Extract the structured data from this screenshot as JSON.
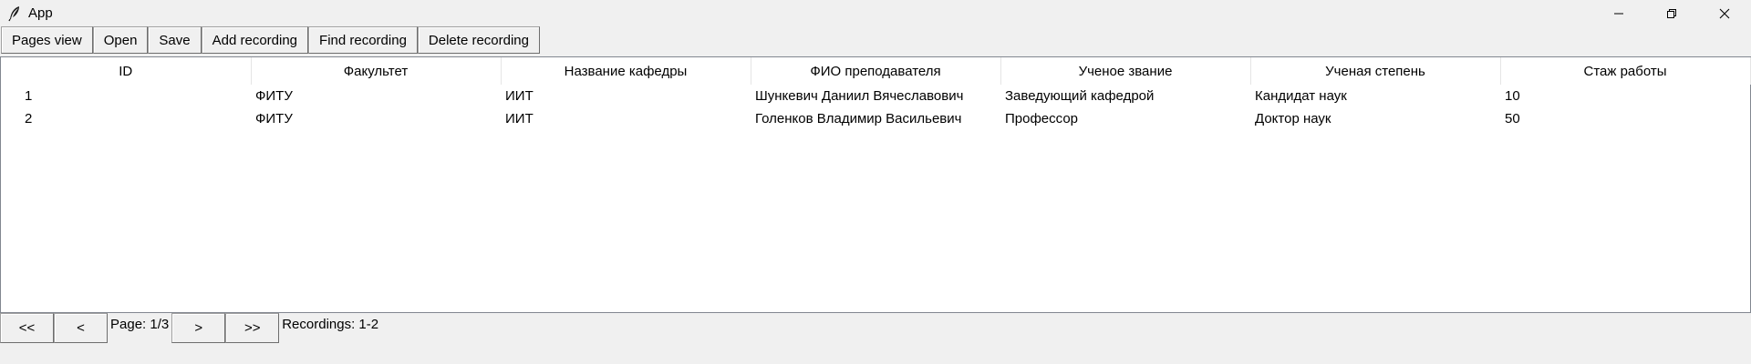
{
  "window": {
    "title": "App",
    "icon": "feather-icon"
  },
  "toolbar": {
    "buttons": [
      "Pages view",
      "Open",
      "Save",
      "Add recording",
      "Find recording",
      "Delete recording"
    ]
  },
  "table": {
    "columns": [
      "ID",
      "Факультет",
      "Название кафедры",
      "ФИО преподавателя",
      "Ученое звание",
      "Ученая степень",
      "Стаж работы"
    ],
    "rows": [
      [
        "1",
        "ФИТУ",
        "ИИТ",
        "Шункевич Даниил Вячеславович",
        "Заведующий кафедрой",
        "Кандидат наук",
        "10"
      ],
      [
        "2",
        "ФИТУ",
        "ИИТ",
        "Голенков Владимир Васильевич",
        "Профессор",
        "Доктор наук",
        "50"
      ]
    ]
  },
  "pager": {
    "first": "<<",
    "prev": "<",
    "page_label": "Page: 1/3",
    "next": ">",
    "last": ">>",
    "recordings_label": "Recordings: 1-2"
  }
}
